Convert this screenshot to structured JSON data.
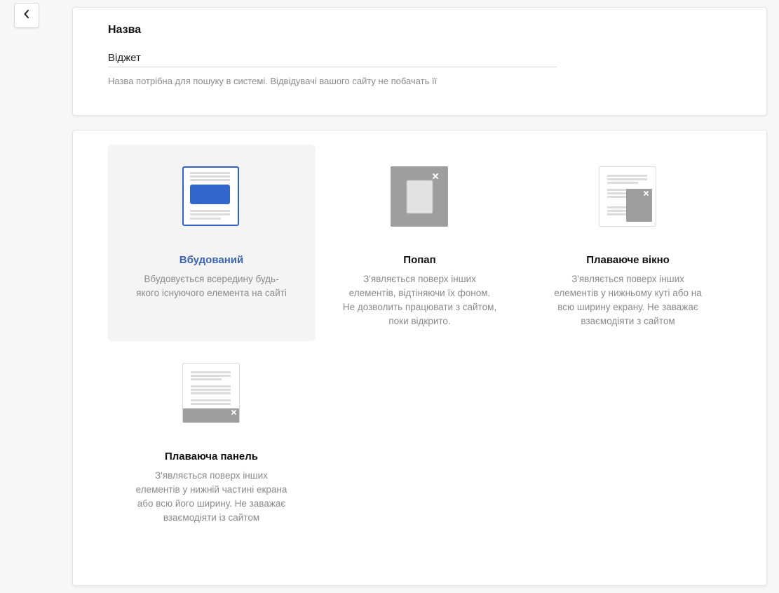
{
  "back_button": {
    "icon": "chevron-left-icon"
  },
  "name_section": {
    "label": "Назва",
    "value": "Віджет",
    "hint": "Назва потрібна для пошуку в системі. Відвідувачі вашого сайту не побачать її"
  },
  "widget_types": [
    {
      "title": "Вбудований",
      "description": "Вбудовується всередину будь-якого існуючого елемента на сайті",
      "icon": "embedded-widget-icon",
      "selected": true
    },
    {
      "title": "Попап",
      "description": "З'являється поверх інших елементів, відтіняючи їх фоном. Не дозволить працювати з сайтом, поки відкрито.",
      "icon": "popup-widget-icon",
      "selected": false
    },
    {
      "title": "Плаваюче вікно",
      "description": "З'являється поверх інших елементів у нижньому куті або на всю ширину екрану. Не заважає взаємодіяти з сайтом",
      "icon": "floating-window-icon",
      "selected": false
    },
    {
      "title": "Плаваюча панель",
      "description": "З'являється поверх інших елементів у нижній частині екрана або всю його ширину. Не заважає взаємодіяти із сайтом",
      "icon": "floating-panel-icon",
      "selected": false
    }
  ],
  "colors": {
    "accent": "#3a63b0",
    "accent_fill": "#3366cc",
    "selected_bg": "#f4f4f4",
    "muted_text": "#8a8a8a",
    "icon_gray": "#9e9e9e"
  }
}
